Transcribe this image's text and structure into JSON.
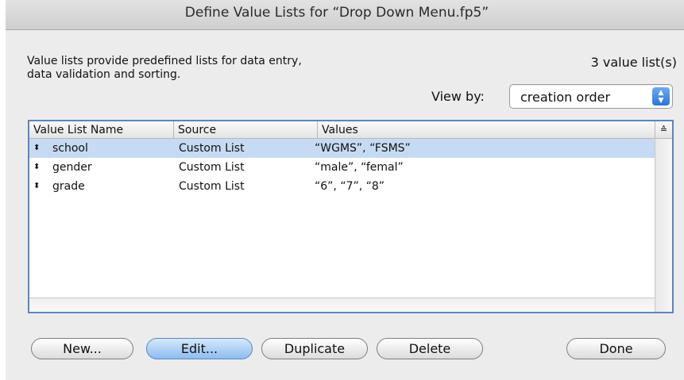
{
  "window": {
    "title": "Define Value Lists for “Drop Down Menu.fp5”"
  },
  "description": "Value lists provide predefined lists for data entry, data validation and sorting.",
  "count_label": "3 value list(s)",
  "view_by": {
    "label": "View by:",
    "selected": "creation order"
  },
  "table": {
    "headers": [
      "Value List Name",
      "Source",
      "Values"
    ],
    "rows": [
      {
        "name": "school",
        "source": "Custom List",
        "values": "“WGMS”, “FSMS”",
        "selected": true
      },
      {
        "name": "gender",
        "source": "Custom List",
        "values": "“male”, “femal”",
        "selected": false
      },
      {
        "name": "grade",
        "source": "Custom List",
        "values": "“6”, “7”, “8”",
        "selected": false
      }
    ]
  },
  "buttons": {
    "new": "New...",
    "edit": "Edit...",
    "duplicate": "Duplicate",
    "delete": "Delete",
    "done": "Done"
  },
  "icons": {
    "row_grip": "updown-arrows-icon",
    "sort": "sort-icon",
    "select_arrows": "select-arrows-icon"
  },
  "colors": {
    "accent": "#2d74d9",
    "selection": "#c6dbf3",
    "table_border": "#5b86bd"
  }
}
